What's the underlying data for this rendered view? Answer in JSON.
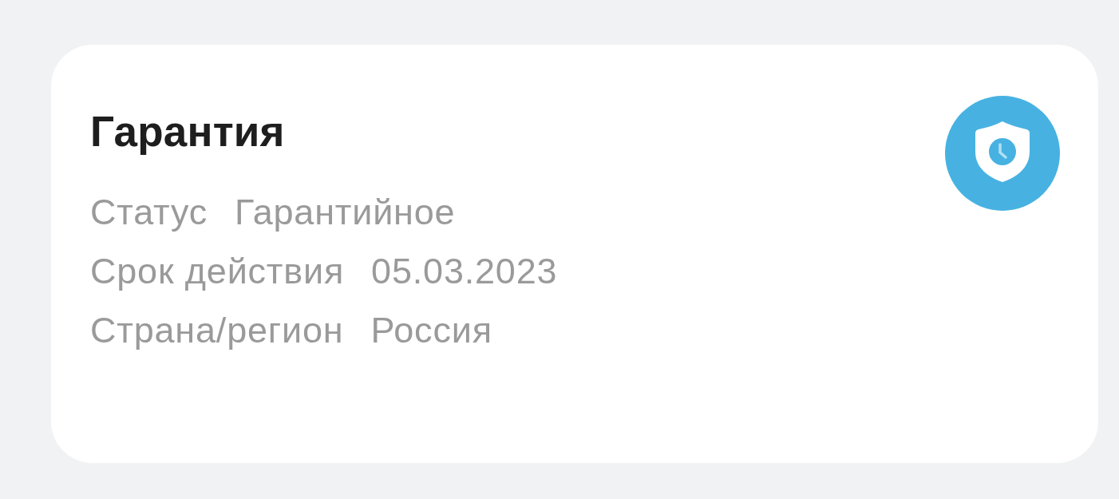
{
  "card": {
    "title": "Гарантия",
    "rows": [
      {
        "label": "Статус",
        "value": "Гарантийное"
      },
      {
        "label": "Срок действия",
        "value": "05.03.2023"
      },
      {
        "label": "Страна/регион",
        "value": "Россия"
      }
    ]
  }
}
